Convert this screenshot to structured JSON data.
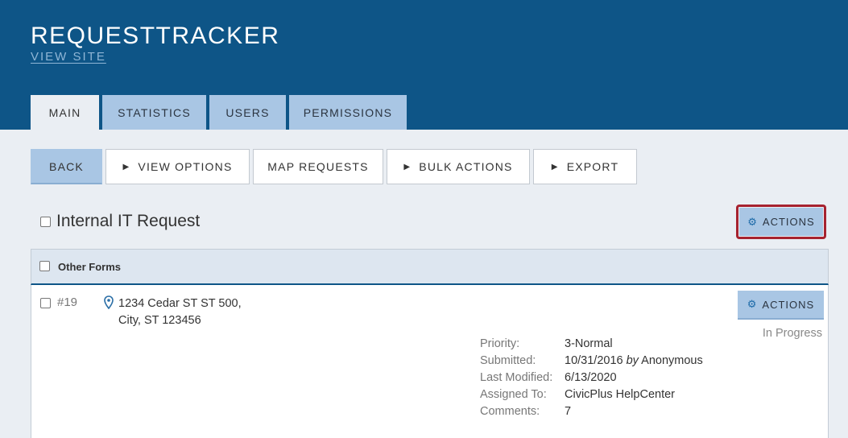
{
  "header": {
    "app_title": "REQUESTTRACKER",
    "view_site": "VIEW SITE"
  },
  "tabs": [
    {
      "label": "MAIN",
      "active": true
    },
    {
      "label": "STATISTICS",
      "active": false
    },
    {
      "label": "USERS",
      "active": false
    },
    {
      "label": "PERMISSIONS",
      "active": false
    }
  ],
  "toolbar": {
    "back": "BACK",
    "view_options": "VIEW OPTIONS",
    "map_requests": "MAP REQUESTS",
    "bulk_actions": "BULK ACTIONS",
    "export": "EXPORT"
  },
  "form": {
    "title": "Internal IT Request",
    "actions_label": "ACTIONS"
  },
  "list": {
    "group_label": "Other Forms",
    "items": [
      {
        "number": "#19",
        "address_line1": "1234 Cedar ST ST 500,",
        "address_line2": "City, ST 123456",
        "actions_label": "ACTIONS",
        "status": "In Progress",
        "details": {
          "priority_label": "Priority:",
          "priority": "3-Normal",
          "submitted_label": "Submitted:",
          "submitted_date": "10/31/2016",
          "submitted_by_word": "by",
          "submitted_by": "Anonymous",
          "modified_label": "Last Modified:",
          "modified": "6/13/2020",
          "assigned_label": "Assigned To:",
          "assigned": "CivicPlus HelpCenter",
          "comments_label": "Comments:",
          "comments": "7"
        }
      }
    ]
  },
  "colors": {
    "header_bg": "#0e5587",
    "tab_bg": "#a9c6e4",
    "highlight_outline": "#a6222f"
  }
}
